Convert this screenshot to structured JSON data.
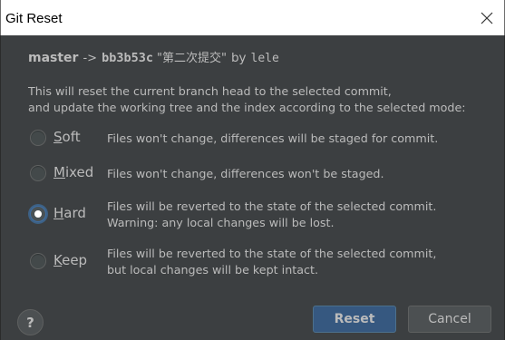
{
  "dialog": {
    "title": "Git Reset"
  },
  "commit": {
    "branch": "master",
    "arrow": "->",
    "hash": "bb3b53c",
    "message": "\"第二次提交\"",
    "by": "by",
    "author": "lele"
  },
  "description": {
    "line1": "This will reset the current branch head to the selected commit,",
    "line2": "and update the working tree and the index according to the selected mode:"
  },
  "options": [
    {
      "mnemonic": "S",
      "rest": "oft",
      "desc1": "Files won't change, differences will be staged for commit.",
      "desc2": "",
      "checked": false
    },
    {
      "mnemonic": "M",
      "rest": "ixed",
      "desc1": "Files won't change, differences won't be staged.",
      "desc2": "",
      "checked": false
    },
    {
      "mnemonic": "H",
      "rest": "ard",
      "desc1": "Files will be reverted to the state of the selected commit.",
      "desc2": "Warning: any local changes will be lost.",
      "checked": true
    },
    {
      "mnemonic": "K",
      "rest": "eep",
      "desc1": "Files will be reverted to the state of the selected commit,",
      "desc2": "but local changes will be kept intact.",
      "checked": false
    }
  ],
  "buttons": {
    "help": "?",
    "reset": "Reset",
    "cancel": "Cancel"
  },
  "colors": {
    "background": "#3c3f41",
    "text": "#bbbbbb",
    "primary_button": "#365880",
    "radio_focus": "#3d6185"
  },
  "icons": {
    "close": "close-icon",
    "help": "help-icon"
  }
}
